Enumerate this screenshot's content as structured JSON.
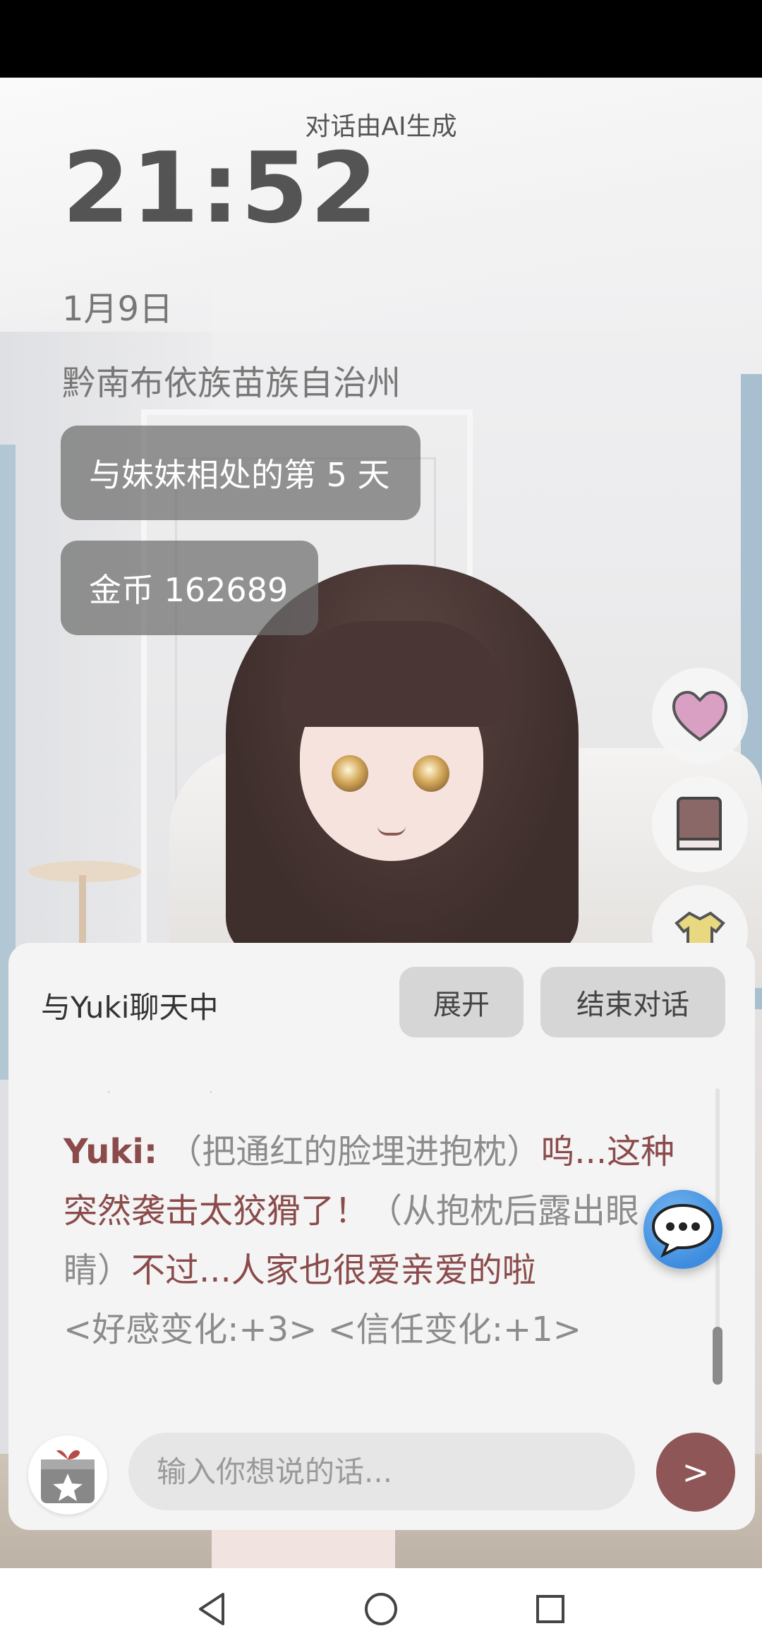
{
  "ai_note": "对话由AI生成",
  "clock": "21:52",
  "date": "1月9日",
  "location": "黔南布依族苗族自治州",
  "days_pill": "与妹妹相处的第 5 天",
  "coins_pill": "金币 162689",
  "side_buttons": [
    {
      "name": "heart-icon",
      "color": "#d9a0c4"
    },
    {
      "name": "book-icon",
      "color": "#8a6868"
    },
    {
      "name": "shirt-icon",
      "color": "#e8d880"
    }
  ],
  "chat": {
    "title": "与Yuki聊天中",
    "expand_label": "展开",
    "end_label": "结束对话",
    "message": {
      "speaker": "Yuki:",
      "action1": "（把通红的脸埋进抱枕）",
      "speech1": "呜...这种突然袭击太狡猾了！",
      "action2": "（从抱枕后露出眼睛）",
      "speech2": "不过...人家也很爱亲爱的啦",
      "effects": "<好感变化:+3> <信任变化:+1>"
    },
    "input_placeholder": "输入你想说的话...",
    "send_label": ">"
  },
  "colors": {
    "accent": "#8e5657",
    "speaker_text": "#8b4b4b",
    "float_chat": "#3d8ce0"
  },
  "nav": [
    "back-icon",
    "home-icon",
    "recents-icon"
  ]
}
